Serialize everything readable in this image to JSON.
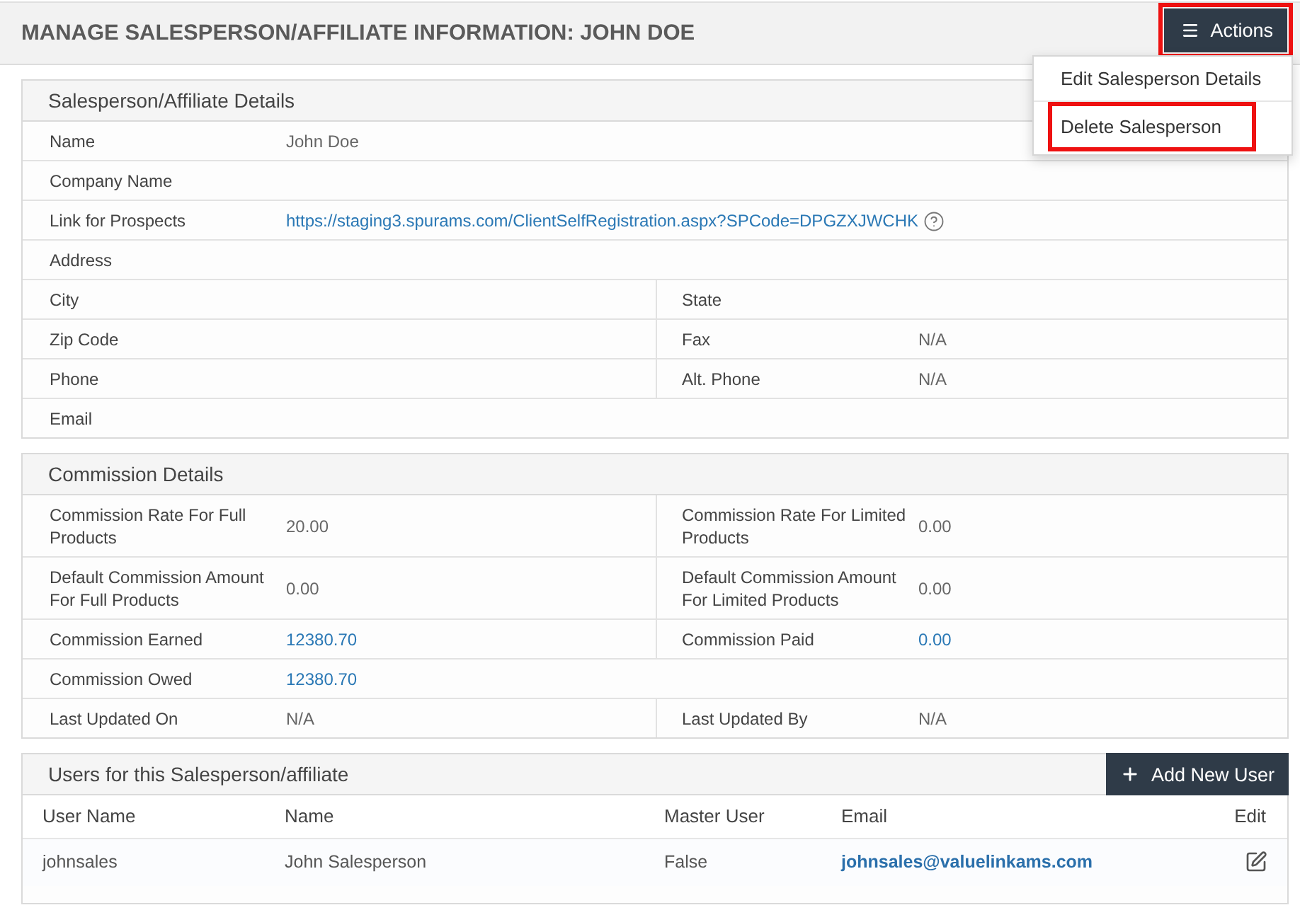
{
  "header": {
    "title": "MANAGE SALESPERSON/AFFILIATE INFORMATION: JOHN DOE",
    "actions_button": {
      "label": "Actions",
      "highlighted": true
    },
    "actions_menu": [
      {
        "label": "Edit Salesperson Details",
        "highlighted": false
      },
      {
        "label": "Delete Salesperson",
        "highlighted": true
      }
    ]
  },
  "details": {
    "title": "Salesperson/Affiliate Details",
    "rows": [
      {
        "fields": [
          {
            "label": "Name",
            "value": "John Doe",
            "kind": "text"
          }
        ]
      },
      {
        "fields": [
          {
            "label": "Company Name"
          }
        ]
      },
      {
        "fields": [
          {
            "label": "Link for Prospects",
            "value": "https://staging3.spurams.com/ClientSelfRegistration.aspx?SPCode=DPGZXJWCHK",
            "kind": "link-help"
          }
        ]
      },
      {
        "fields": [
          {
            "label": "Address"
          }
        ]
      },
      {
        "fields": [
          {
            "label": "City"
          },
          {
            "label": "State"
          }
        ]
      },
      {
        "fields": [
          {
            "label": "Zip Code"
          },
          {
            "label": "Fax",
            "value": "N/A",
            "kind": "text"
          }
        ]
      },
      {
        "fields": [
          {
            "label": "Phone"
          },
          {
            "label": "Alt. Phone",
            "value": "N/A",
            "kind": "text"
          }
        ]
      },
      {
        "fields": [
          {
            "label": "Email"
          }
        ]
      }
    ]
  },
  "commission": {
    "title": "Commission Details",
    "rows": [
      {
        "fields": [
          {
            "label": "Commission Rate For Full Products",
            "value": "20.00",
            "kind": "text"
          },
          {
            "label": "Commission Rate For Limited Products",
            "value": "0.00",
            "kind": "text"
          }
        ]
      },
      {
        "fields": [
          {
            "label": "Default Commission Amount For Full Products",
            "value": "0.00",
            "kind": "text"
          },
          {
            "label": "Default Commission Amount For Limited Products",
            "value": "0.00",
            "kind": "text"
          }
        ]
      },
      {
        "fields": [
          {
            "label": "Commission Earned",
            "value": "12380.70",
            "kind": "link"
          },
          {
            "label": "Commission Paid",
            "value": "0.00",
            "kind": "link"
          }
        ]
      },
      {
        "fields": [
          {
            "label": "Commission Owed",
            "value": "12380.70",
            "kind": "link"
          }
        ]
      },
      {
        "fields": [
          {
            "label": "Last Updated On",
            "value": "N/A",
            "kind": "text"
          },
          {
            "label": "Last Updated By",
            "value": "N/A",
            "kind": "text"
          }
        ]
      }
    ]
  },
  "users": {
    "title": "Users for this Salesperson/affiliate",
    "add_button": {
      "label": "Add New User"
    },
    "columns": [
      "User Name",
      "Name",
      "Master User",
      "Email",
      "Edit"
    ],
    "rows": [
      {
        "user_name": "johnsales",
        "name": "John Salesperson",
        "master_user": "False",
        "email": "johnsales@valuelinkams.com"
      }
    ]
  }
}
